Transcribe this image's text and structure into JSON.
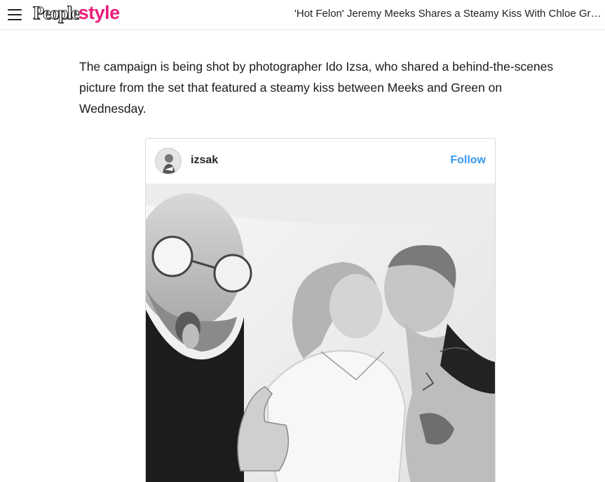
{
  "header": {
    "brand_people": "People",
    "brand_style": "style",
    "headline": "'Hot Felon' Jeremy Meeks Shares a Steamy Kiss With Chloe Green"
  },
  "article": {
    "paragraph": "The campaign is being shot by photographer Ido Izsa, who shared a behind-the-scenes picture from the set that featured a steamy kiss between Meeks and Green on Wednesday."
  },
  "instagram": {
    "username": "izsak",
    "follow_label": "Follow"
  },
  "colors": {
    "brand_pink": "#ec1d7a",
    "follow_blue": "#3897f0"
  }
}
